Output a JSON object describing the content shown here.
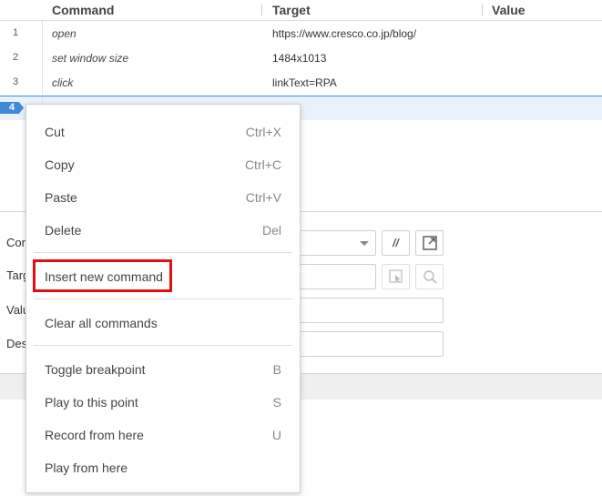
{
  "table": {
    "headers": {
      "command": "Command",
      "target": "Target",
      "value": "Value"
    },
    "rows": [
      {
        "num": "1",
        "command": "open",
        "target": "https://www.cresco.co.jp/blog/"
      },
      {
        "num": "2",
        "command": "set window size",
        "target": "1484x1013"
      },
      {
        "num": "3",
        "command": "click",
        "target": "linkText=RPA"
      },
      {
        "num": "4",
        "command": "",
        "target": ""
      }
    ]
  },
  "editor": {
    "labels": {
      "command": "Cor",
      "target": "Targ",
      "value": "Valu",
      "description": "Des"
    },
    "comment_button": "//"
  },
  "context_menu": {
    "items": [
      {
        "label": "Cut",
        "shortcut": "Ctrl+X"
      },
      {
        "label": "Copy",
        "shortcut": "Ctrl+C"
      },
      {
        "label": "Paste",
        "shortcut": "Ctrl+V"
      },
      {
        "label": "Delete",
        "shortcut": "Del"
      },
      {
        "label": "Insert new command",
        "shortcut": ""
      },
      {
        "label": "Clear all commands",
        "shortcut": ""
      },
      {
        "label": "Toggle breakpoint",
        "shortcut": "B"
      },
      {
        "label": "Play to this point",
        "shortcut": "S"
      },
      {
        "label": "Record from here",
        "shortcut": "U"
      },
      {
        "label": "Play from here",
        "shortcut": ""
      }
    ]
  },
  "colors": {
    "selection": "#3c8ad8",
    "highlight_box": "#e01010"
  }
}
